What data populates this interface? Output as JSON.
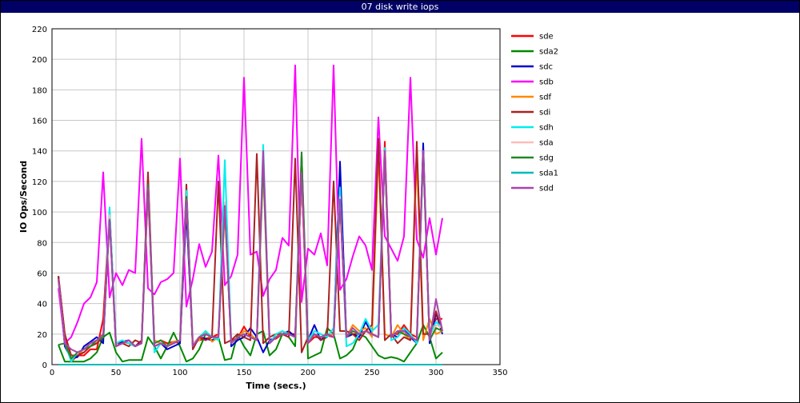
{
  "window": {
    "title": "07 disk write iops"
  },
  "chart_data": {
    "type": "line",
    "xlabel": "Time (secs.)",
    "ylabel": "IO Ops/Second",
    "xlim": [
      0,
      350
    ],
    "ylim": [
      0,
      220
    ],
    "xticks": [
      0,
      50,
      100,
      150,
      200,
      250,
      300,
      350
    ],
    "yticks": [
      0,
      20,
      40,
      60,
      80,
      100,
      120,
      140,
      160,
      180,
      200,
      220
    ],
    "grid": true,
    "legend_position": "right",
    "x": [
      5,
      10,
      15,
      20,
      25,
      30,
      35,
      40,
      45,
      50,
      55,
      60,
      65,
      70,
      75,
      80,
      85,
      90,
      95,
      100,
      105,
      110,
      115,
      120,
      125,
      130,
      135,
      140,
      145,
      150,
      155,
      160,
      165,
      170,
      175,
      180,
      185,
      190,
      195,
      200,
      205,
      210,
      215,
      220,
      225,
      230,
      235,
      240,
      245,
      250,
      255,
      260,
      265,
      270,
      275,
      280,
      285,
      290,
      295,
      300,
      305
    ],
    "series": [
      {
        "name": "sde",
        "color": "#ff0000",
        "values": [
          58,
          20,
          2,
          6,
          6,
          10,
          10,
          30,
          100,
          12,
          15,
          14,
          12,
          16,
          115,
          14,
          16,
          14,
          15,
          14,
          112,
          14,
          16,
          17,
          18,
          20,
          105,
          16,
          17,
          25,
          18,
          16,
          135,
          16,
          17,
          20,
          20,
          20,
          122,
          14,
          18,
          18,
          19,
          18,
          109,
          18,
          20,
          20,
          22,
          20,
          18,
          146,
          20,
          20,
          26,
          20,
          18,
          140,
          16,
          30,
          30
        ]
      },
      {
        "name": "sda2",
        "color": "#008800",
        "values": [
          13,
          2,
          2,
          2,
          2,
          4,
          8,
          18,
          21,
          8,
          2,
          3,
          3,
          3,
          18,
          12,
          4,
          12,
          21,
          12,
          2,
          4,
          10,
          20,
          18,
          18,
          3,
          4,
          20,
          12,
          6,
          20,
          22,
          6,
          10,
          20,
          18,
          12,
          139,
          4,
          6,
          8,
          24,
          20,
          4,
          6,
          10,
          20,
          18,
          12,
          6,
          4,
          5,
          4,
          2,
          8,
          14,
          26,
          18,
          4,
          8
        ]
      },
      {
        "name": "sdc",
        "color": "#0000cc",
        "values": [
          58,
          12,
          4,
          5,
          12,
          15,
          18,
          14,
          100,
          14,
          15,
          16,
          12,
          15,
          118,
          12,
          14,
          10,
          12,
          14,
          100,
          12,
          18,
          17,
          16,
          18,
          106,
          12,
          16,
          18,
          24,
          18,
          8,
          16,
          18,
          20,
          22,
          18,
          128,
          16,
          26,
          16,
          20,
          18,
          133,
          18,
          20,
          18,
          28,
          20,
          18,
          140,
          20,
          18,
          24,
          18,
          14,
          145,
          14,
          34,
          20
        ]
      },
      {
        "name": "sdb",
        "color": "#ff00ff",
        "values": [
          50,
          14,
          18,
          28,
          40,
          44,
          54,
          126,
          44,
          60,
          52,
          62,
          60,
          148,
          50,
          46,
          54,
          56,
          60,
          135,
          38,
          56,
          79,
          64,
          74,
          137,
          52,
          58,
          72,
          188,
          72,
          74,
          45,
          56,
          62,
          83,
          78,
          196,
          41,
          76,
          72,
          86,
          65,
          196,
          49,
          56,
          71,
          84,
          78,
          62,
          162,
          84,
          76,
          68,
          84,
          188,
          82,
          70,
          96,
          72,
          96
        ]
      },
      {
        "name": "sdf",
        "color": "#ff8800",
        "values": [
          58,
          14,
          3,
          8,
          8,
          12,
          14,
          20,
          96,
          14,
          16,
          14,
          12,
          14,
          112,
          16,
          14,
          12,
          15,
          16,
          108,
          14,
          16,
          22,
          15,
          18,
          100,
          14,
          18,
          22,
          20,
          16,
          128,
          14,
          18,
          22,
          20,
          18,
          122,
          14,
          20,
          18,
          19,
          20,
          106,
          18,
          26,
          22,
          24,
          18,
          140,
          20,
          18,
          26,
          20,
          16,
          136,
          16,
          30,
          20,
          22
        ]
      },
      {
        "name": "sdi",
        "color": "#aa2222",
        "values": [
          58,
          20,
          6,
          6,
          8,
          12,
          14,
          18,
          97,
          12,
          14,
          12,
          16,
          14,
          126,
          12,
          14,
          12,
          14,
          16,
          118,
          10,
          18,
          16,
          18,
          120,
          14,
          16,
          20,
          18,
          16,
          138,
          14,
          18,
          20,
          20,
          18,
          135,
          8,
          18,
          20,
          16,
          18,
          120,
          22,
          22,
          20,
          16,
          22,
          26,
          148,
          16,
          20,
          14,
          18,
          16,
          146,
          20,
          20,
          35,
          22
        ]
      },
      {
        "name": "sdh",
        "color": "#00eeee",
        "values": [
          56,
          14,
          2,
          8,
          10,
          14,
          16,
          18,
          103,
          14,
          16,
          14,
          12,
          14,
          118,
          8,
          14,
          12,
          14,
          16,
          114,
          14,
          18,
          22,
          18,
          16,
          134,
          14,
          18,
          20,
          18,
          16,
          144,
          14,
          20,
          22,
          20,
          18,
          131,
          16,
          22,
          20,
          18,
          24,
          116,
          12,
          14,
          20,
          30,
          22,
          26,
          142,
          16,
          18,
          24,
          20,
          14,
          138,
          18,
          28,
          24
        ]
      },
      {
        "name": "sda",
        "color": "#ffbbbb",
        "values": [
          55,
          14,
          4,
          8,
          10,
          14,
          16,
          18,
          98,
          12,
          14,
          16,
          12,
          14,
          116,
          14,
          16,
          12,
          14,
          16,
          110,
          14,
          18,
          20,
          18,
          18,
          106,
          14,
          18,
          20,
          18,
          16,
          130,
          14,
          18,
          20,
          20,
          18,
          125,
          14,
          20,
          18,
          20,
          18,
          110,
          18,
          22,
          20,
          22,
          20,
          18,
          140,
          18,
          22,
          22,
          18,
          16,
          140,
          16,
          26,
          24
        ]
      },
      {
        "name": "sdg",
        "color": "#228822",
        "values": [
          13,
          14,
          4,
          8,
          10,
          12,
          16,
          18,
          95,
          12,
          14,
          16,
          12,
          14,
          118,
          14,
          16,
          12,
          14,
          16,
          110,
          12,
          18,
          20,
          18,
          18,
          104,
          14,
          18,
          20,
          18,
          16,
          132,
          14,
          18,
          20,
          20,
          18,
          138,
          14,
          20,
          18,
          20,
          18,
          108,
          18,
          22,
          20,
          22,
          20,
          18,
          138,
          18,
          22,
          20,
          18,
          16,
          138,
          16,
          24,
          22
        ]
      },
      {
        "name": "sda1",
        "color": "#00bbbb",
        "values": [
          0,
          0,
          0,
          0,
          0,
          0,
          0,
          0,
          0,
          0,
          0,
          0,
          0,
          0,
          0,
          0,
          0,
          0,
          0,
          0,
          0,
          0,
          0,
          0,
          0,
          0,
          0,
          0,
          0,
          0,
          0,
          0,
          0,
          0,
          0,
          0,
          0,
          0,
          0,
          0,
          0,
          0,
          0,
          0,
          0,
          0,
          0,
          0,
          0,
          0,
          0,
          0,
          0,
          0,
          0,
          0,
          0,
          0,
          0,
          0,
          0
        ]
      },
      {
        "name": "sdd",
        "color": "#aa44aa",
        "values": [
          56,
          14,
          10,
          8,
          10,
          14,
          16,
          20,
          95,
          12,
          14,
          16,
          12,
          14,
          116,
          12,
          14,
          12,
          14,
          16,
          108,
          12,
          18,
          20,
          18,
          18,
          104,
          14,
          18,
          20,
          18,
          16,
          140,
          14,
          18,
          20,
          20,
          18,
          126,
          14,
          20,
          18,
          20,
          18,
          108,
          18,
          24,
          20,
          22,
          20,
          18,
          140,
          18,
          22,
          22,
          18,
          16,
          140,
          16,
          43,
          22
        ]
      }
    ]
  }
}
